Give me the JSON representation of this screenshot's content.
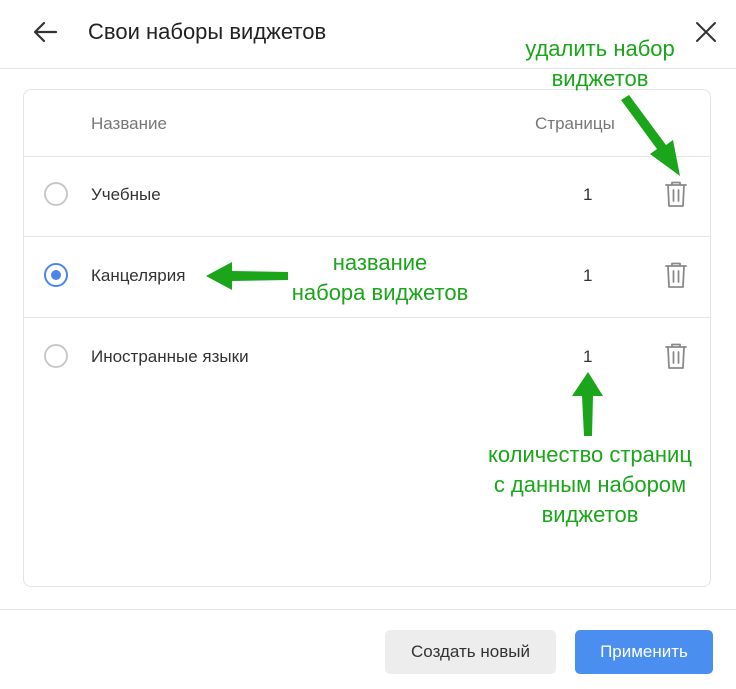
{
  "header": {
    "title": "Свои наборы виджетов",
    "back_icon": "arrow-left-icon",
    "close_icon": "close-icon"
  },
  "table": {
    "col_name": "Название",
    "col_pages": "Страницы",
    "rows": [
      {
        "name": "Учебные",
        "pages": "1",
        "selected": false
      },
      {
        "name": "Канцелярия",
        "pages": "1",
        "selected": true
      },
      {
        "name": "Иностранные языки",
        "pages": "1",
        "selected": false
      }
    ]
  },
  "footer": {
    "create_label": "Создать новый",
    "apply_label": "Применить"
  },
  "annotations": {
    "delete_line1": "удалить набор",
    "delete_line2": "виджетов",
    "name_line1": "название",
    "name_line2": "набора виджетов",
    "count_line1": "количество страниц",
    "count_line2": "с данным набором",
    "count_line3": "виджетов"
  },
  "colors": {
    "accent": "#4a86e8",
    "apply_button": "#4a8ef0",
    "annotation": "#1aa51a"
  }
}
